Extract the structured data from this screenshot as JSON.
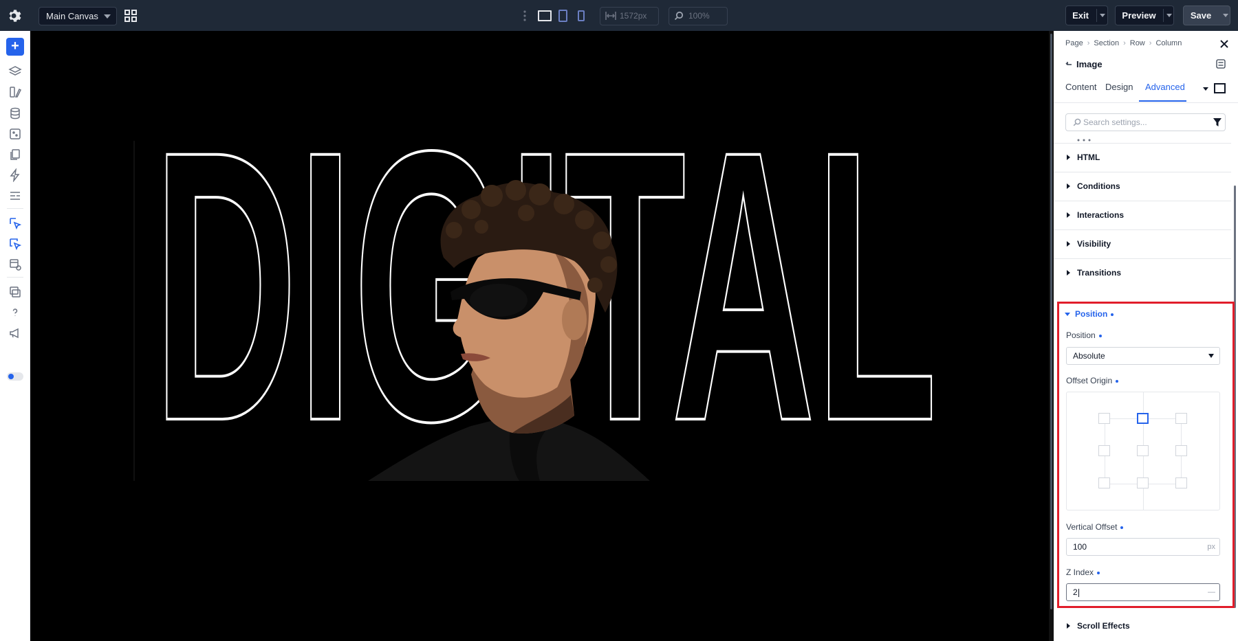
{
  "topbar": {
    "canvas_label": "Main Canvas",
    "width_value": "1572px",
    "zoom_value": "100%",
    "exit_label": "Exit",
    "preview_label": "Preview",
    "save_label": "Save"
  },
  "canvas": {
    "headline": "DIGITAL"
  },
  "panel": {
    "breadcrumb": [
      "Page",
      "Section",
      "Row",
      "Column"
    ],
    "element_title": "Image",
    "tabs": [
      {
        "label": "Content"
      },
      {
        "label": "Design"
      },
      {
        "label": "Advanced",
        "active": true
      }
    ],
    "search_placeholder": "Search settings...",
    "sections": [
      {
        "label": "HTML"
      },
      {
        "label": "Conditions"
      },
      {
        "label": "Interactions"
      },
      {
        "label": "Visibility"
      },
      {
        "label": "Transitions"
      }
    ],
    "position": {
      "heading": "Position",
      "position_label": "Position",
      "position_value": "Absolute",
      "offset_origin_label": "Offset Origin",
      "offset_origin_selected": "top-center",
      "vertical_offset_label": "Vertical Offset",
      "vertical_offset_value": "100",
      "vertical_offset_unit": "px",
      "z_index_label": "Z Index",
      "z_index_value": "2",
      "z_index_unit": "—"
    },
    "scroll_effects_label": "Scroll Effects"
  },
  "colors": {
    "accent": "#2563eb",
    "highlight_border": "#e11d2a",
    "topbar_bg": "#1f2937"
  }
}
